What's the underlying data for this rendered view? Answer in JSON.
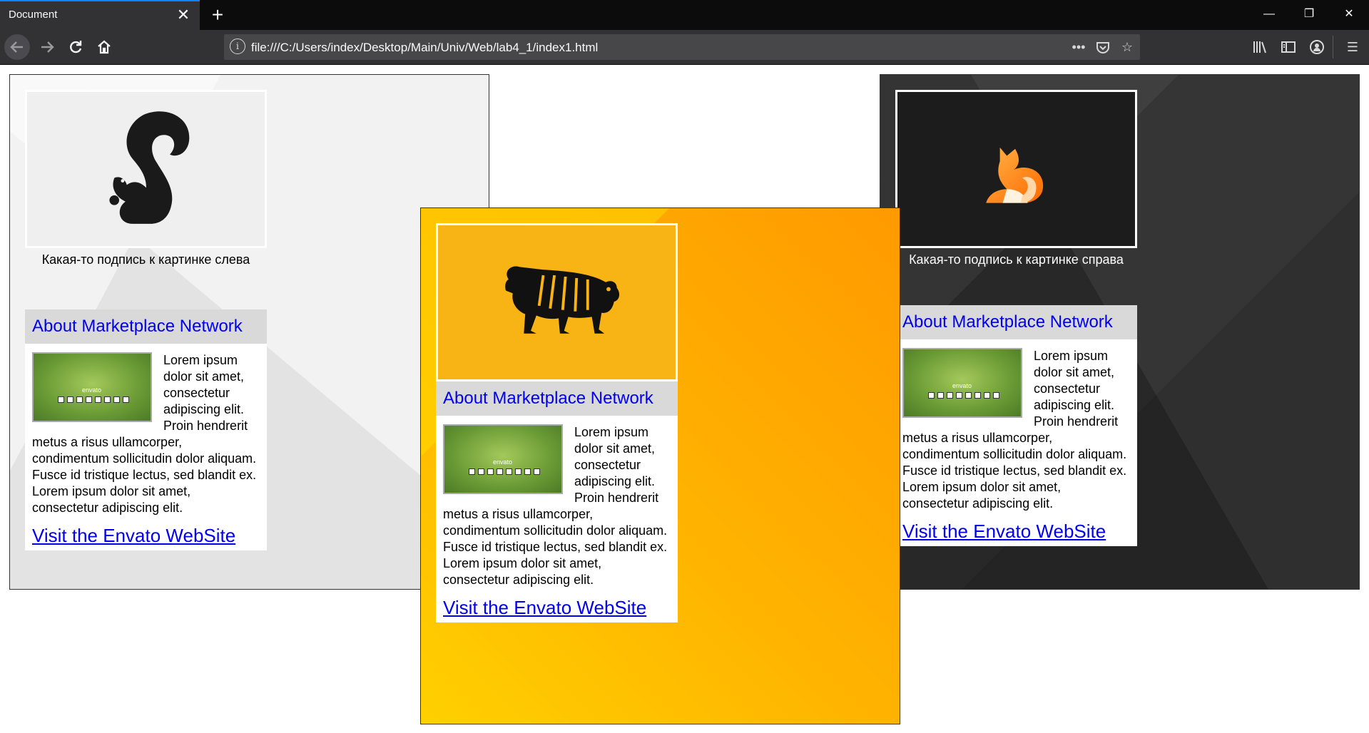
{
  "browser": {
    "tab_title": "Document",
    "tab_close": "✕",
    "new_tab": "+",
    "url": "file:///C:/Users/index/Desktop/Main/Univ/Web/lab4_1/index1.html",
    "window_minimize": "—",
    "window_restore": "❐",
    "window_close": "✕"
  },
  "left_panel": {
    "caption": "Какая-то подпись к картинке слева",
    "icon": "squirrel-logo"
  },
  "middle_panel": {
    "icon": "tiger-logo"
  },
  "right_panel": {
    "caption": "Какая-то подпись к картинке справа",
    "icon": "fox-logo"
  },
  "card": {
    "heading": "About Marketplace Network",
    "thumb_logo": "envato",
    "text": "Lorem ipsum dolor sit amet, consectetur adipiscing elit. Proin hendrerit metus a risus ullamcorper, condimentum sollicitudin dolor aliquam. Fusce id tristique lectus, sed blandit ex. Lorem ipsum dolor sit amet, consectetur adipiscing elit.",
    "link": "Visit the Envato WebSite"
  }
}
